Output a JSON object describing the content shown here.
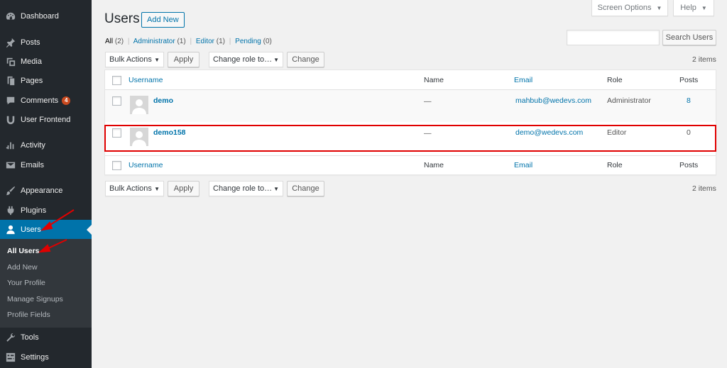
{
  "sidebar": {
    "items": [
      {
        "label": "Dashboard",
        "icon": "dashboard-icon"
      },
      {
        "label": "Posts",
        "icon": "pin-icon"
      },
      {
        "label": "Media",
        "icon": "media-icon"
      },
      {
        "label": "Pages",
        "icon": "pages-icon"
      },
      {
        "label": "Comments",
        "icon": "comments-icon",
        "badge": "4"
      },
      {
        "label": "User Frontend",
        "icon": "user-frontend-icon"
      },
      {
        "label": "Activity",
        "icon": "activity-icon"
      },
      {
        "label": "Emails",
        "icon": "email-icon"
      },
      {
        "label": "Appearance",
        "icon": "appearance-icon"
      },
      {
        "label": "Plugins",
        "icon": "plugins-icon"
      },
      {
        "label": "Users",
        "icon": "users-icon"
      },
      {
        "label": "Tools",
        "icon": "tools-icon"
      },
      {
        "label": "Settings",
        "icon": "settings-icon"
      }
    ],
    "submenu": [
      "All Users",
      "Add New",
      "Your Profile",
      "Manage Signups",
      "Profile Fields"
    ]
  },
  "top": {
    "screen_options": "Screen Options",
    "help": "Help"
  },
  "page": {
    "title": "Users",
    "add_new": "Add New"
  },
  "filters": {
    "all": "All",
    "all_count": "(2)",
    "admin": "Administrator",
    "admin_count": "(1)",
    "editor": "Editor",
    "editor_count": "(1)",
    "pending": "Pending",
    "pending_count": "(0)",
    "separator": "|"
  },
  "search": {
    "button": "Search Users",
    "value": ""
  },
  "bulk": {
    "action": "Bulk Actions",
    "apply": "Apply",
    "role": "Change role to…",
    "change": "Change"
  },
  "items_count": "2 items",
  "table": {
    "columns": {
      "username": "Username",
      "name": "Name",
      "email": "Email",
      "role": "Role",
      "posts": "Posts"
    },
    "rows": [
      {
        "username": "demo",
        "name": "—",
        "email": "mahbub@wedevs.com",
        "role": "Administrator",
        "posts": "8"
      },
      {
        "username": "demo158",
        "name": "—",
        "email": "demo@wedevs.com",
        "role": "Editor",
        "posts": "0"
      }
    ]
  },
  "colors": {
    "accent": "#0073aa",
    "sidebar": "#23282d",
    "highlight": "#e00000",
    "badge": "#ca4a1f"
  }
}
